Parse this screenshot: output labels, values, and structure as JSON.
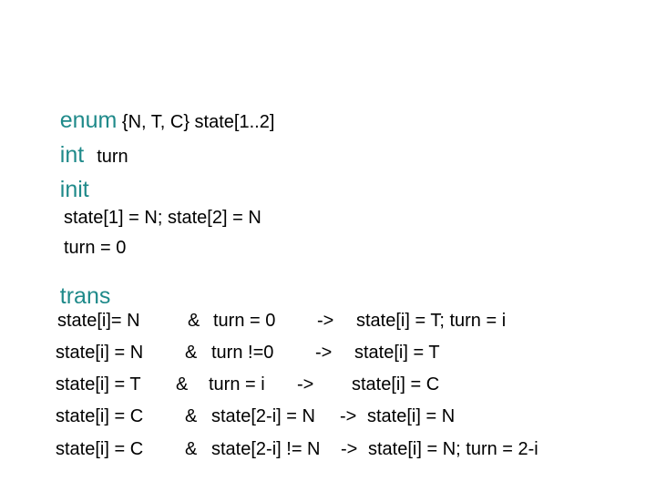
{
  "declarations": {
    "enum_keyword": "enum",
    "enum_body": " {N, T, C} state[1..2]",
    "int_keyword": "int",
    "int_body": "turn",
    "init_keyword": "init",
    "init_lines": [
      "state[1] = N; state[2] = N",
      "turn = 0"
    ],
    "trans_keyword": "trans"
  },
  "transitions": [
    {
      "guard_state": "state[i]= N",
      "amp": "&",
      "guard_cond": "turn = 0",
      "arrow": "->",
      "action": "state[i] = T; turn = i"
    },
    {
      "guard_state": "state[i] = N",
      "amp": "&",
      "guard_cond": "turn !=0",
      "arrow": "->",
      "action": "state[i] = T"
    },
    {
      "guard_state": "state[i] = T",
      "amp": "&",
      "guard_cond": "turn = i",
      "arrow": "->",
      "action": "state[i] = C"
    },
    {
      "guard_state": "state[i] = C",
      "amp": "&",
      "guard_cond": "state[2-i] = N",
      "arrow": "->",
      "action": "state[i] = N"
    },
    {
      "guard_state": "state[i] = C",
      "amp": "&",
      "guard_cond": "state[2-i] != N",
      "arrow": "->",
      "action": "state[i] = N; turn = 2-i"
    }
  ],
  "colors": {
    "keyword": "#1f8a8a",
    "text": "#000000",
    "background": "#ffffff"
  }
}
